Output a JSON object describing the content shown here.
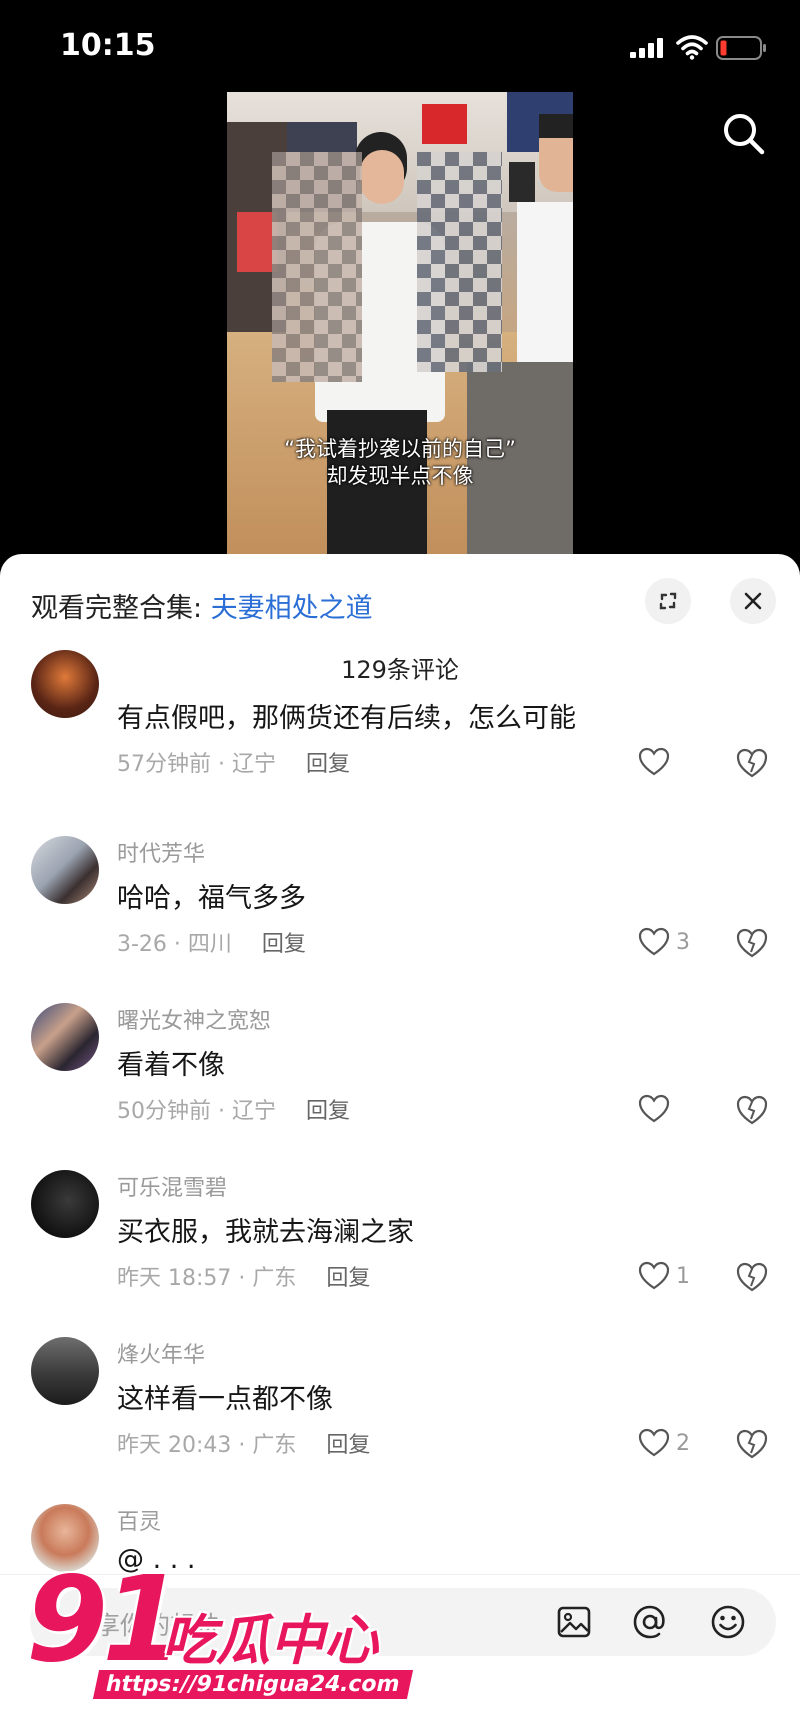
{
  "status_bar": {
    "time": "10:15"
  },
  "video": {
    "subtitle_line1": "“我试着抄袭以前的自己”",
    "subtitle_line2": "却发现半点不像"
  },
  "sheet": {
    "collection_label": "观看完整合集: ",
    "collection_name": "夫妻相处之道",
    "comment_count": "129条评论",
    "reply_label": "回复"
  },
  "comments": [
    {
      "username": "",
      "text": "有点假吧，那俩货还有后续，怎么可能",
      "meta": "57分钟前 · 辽宁",
      "likes": ""
    },
    {
      "username": "时代芳华",
      "text": "哈哈，福气多多",
      "meta": "3-26 · 四川",
      "likes": "3"
    },
    {
      "username": "曙光女神之宽恕",
      "text": "看着不像",
      "meta": "50分钟前 · 辽宁",
      "likes": ""
    },
    {
      "username": "可乐混雪碧",
      "text": "买衣服，我就去海澜之家",
      "meta": "昨天 18:57 · 广东",
      "likes": "1"
    },
    {
      "username": "烽火年华",
      "text": "这样看一点都不像",
      "meta": "昨天 20:43 · 广东",
      "likes": "2"
    },
    {
      "username": "百灵",
      "text": "@ . . .",
      "meta": "",
      "likes": ""
    }
  ],
  "input": {
    "placeholder": "分享你的想法"
  },
  "watermark": {
    "number": "91",
    "title": "吃瓜中心",
    "url": "https://91chigua24.com"
  },
  "colors": {
    "link": "#2b6fd6",
    "watermark": "#e8175d",
    "battery_low": "#ff3b30"
  }
}
